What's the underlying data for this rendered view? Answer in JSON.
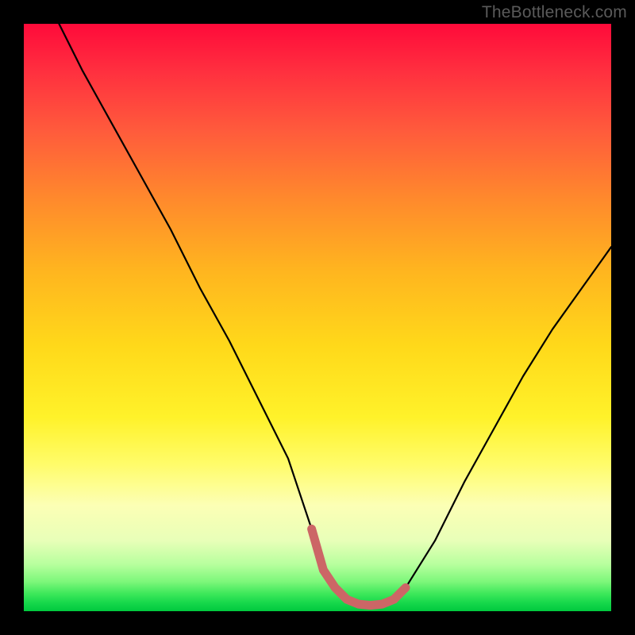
{
  "watermark": "TheBottleneck.com",
  "chart_data": {
    "type": "line",
    "title": "",
    "xlabel": "",
    "ylabel": "",
    "xlim": [
      0,
      100
    ],
    "ylim": [
      0,
      100
    ],
    "series": [
      {
        "name": "bottleneck-curve",
        "x": [
          6,
          10,
          15,
          20,
          25,
          30,
          35,
          40,
          45,
          49,
          51,
          53,
          55,
          57,
          59,
          61,
          63,
          65,
          70,
          75,
          80,
          85,
          90,
          95,
          100
        ],
        "values": [
          100,
          92,
          83,
          74,
          65,
          55,
          46,
          36,
          26,
          14,
          7,
          4,
          2,
          1.2,
          1,
          1.2,
          2,
          4,
          12,
          22,
          31,
          40,
          48,
          55,
          62
        ]
      },
      {
        "name": "optimal-band",
        "x": [
          49,
          51,
          53,
          55,
          57,
          59,
          61,
          63,
          65
        ],
        "values": [
          14,
          7,
          4,
          2,
          1.2,
          1,
          1.2,
          2,
          4
        ]
      }
    ],
    "gradient_stops": [
      {
        "pos": 0.0,
        "color": "#ff0a3a"
      },
      {
        "pos": 0.3,
        "color": "#ff8a2c"
      },
      {
        "pos": 0.55,
        "color": "#ffd91a"
      },
      {
        "pos": 0.82,
        "color": "#fcffb5"
      },
      {
        "pos": 0.95,
        "color": "#7cf77a"
      },
      {
        "pos": 1.0,
        "color": "#00c93e"
      }
    ]
  }
}
